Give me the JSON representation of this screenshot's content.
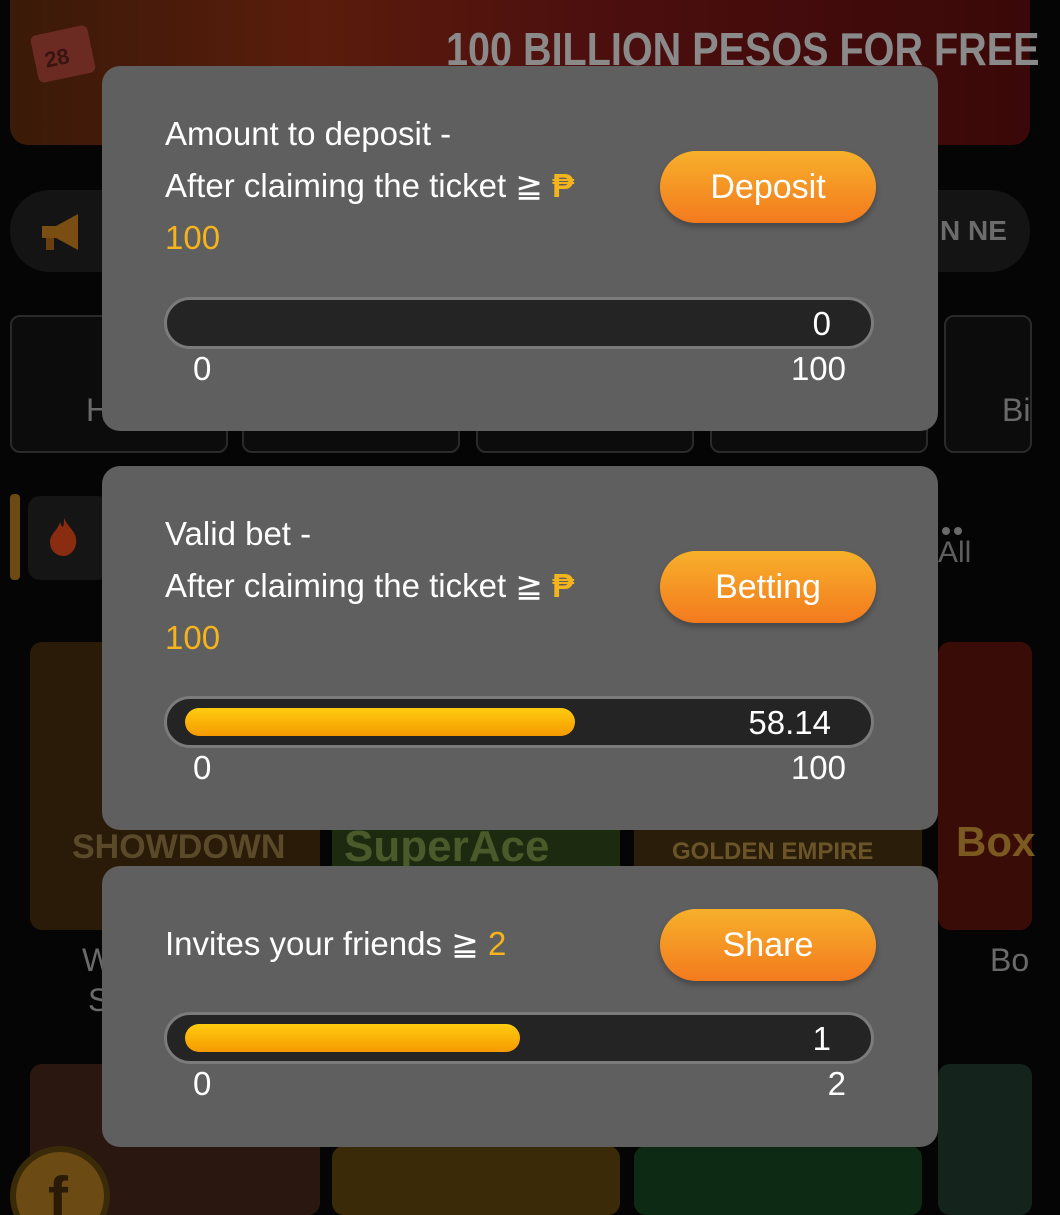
{
  "background": {
    "banner_text": "100 BILLION PESOS FOR FREE",
    "banner_calendar": "28",
    "marquee_text": "N NE",
    "category_left": "H",
    "category_right": "Bi",
    "tab_all": "All",
    "game_showdown": "SHOWDOWN",
    "game_superace": "SuperAce",
    "game_golden_empire": "GOLDEN EMPIRE",
    "game_box": "Box",
    "caption_left_1": "W",
    "caption_left_2": "S",
    "caption_right": "Bo",
    "facebook_glyph": "f"
  },
  "tasks": [
    {
      "title_line1": "Amount to deposit -",
      "title_line2": "After claiming the ticket ≧ ",
      "currency": "₱",
      "target": "100",
      "button_label": "Deposit",
      "progress_value": "0",
      "progress_fraction": 0,
      "range_min": "0",
      "range_max": "100"
    },
    {
      "title_line1": "Valid bet -",
      "title_line2": "After claiming the ticket ≧ ",
      "currency": "₱",
      "target": "100",
      "button_label": "Betting",
      "progress_value": "58.14",
      "progress_fraction": 0.5814,
      "range_min": "0",
      "range_max": "100"
    },
    {
      "title_line1": "Invites your friends ≧ ",
      "target": "2",
      "button_label": "Share",
      "progress_value": "1",
      "progress_fraction": 0.5,
      "range_min": "0",
      "range_max": "2"
    }
  ],
  "colors": {
    "card_bg": "#5f5f5f",
    "accent_gold": "#f5b31c",
    "button_top": "#f7b02b",
    "button_bottom": "#f37a1e",
    "track_bg": "#242424"
  }
}
